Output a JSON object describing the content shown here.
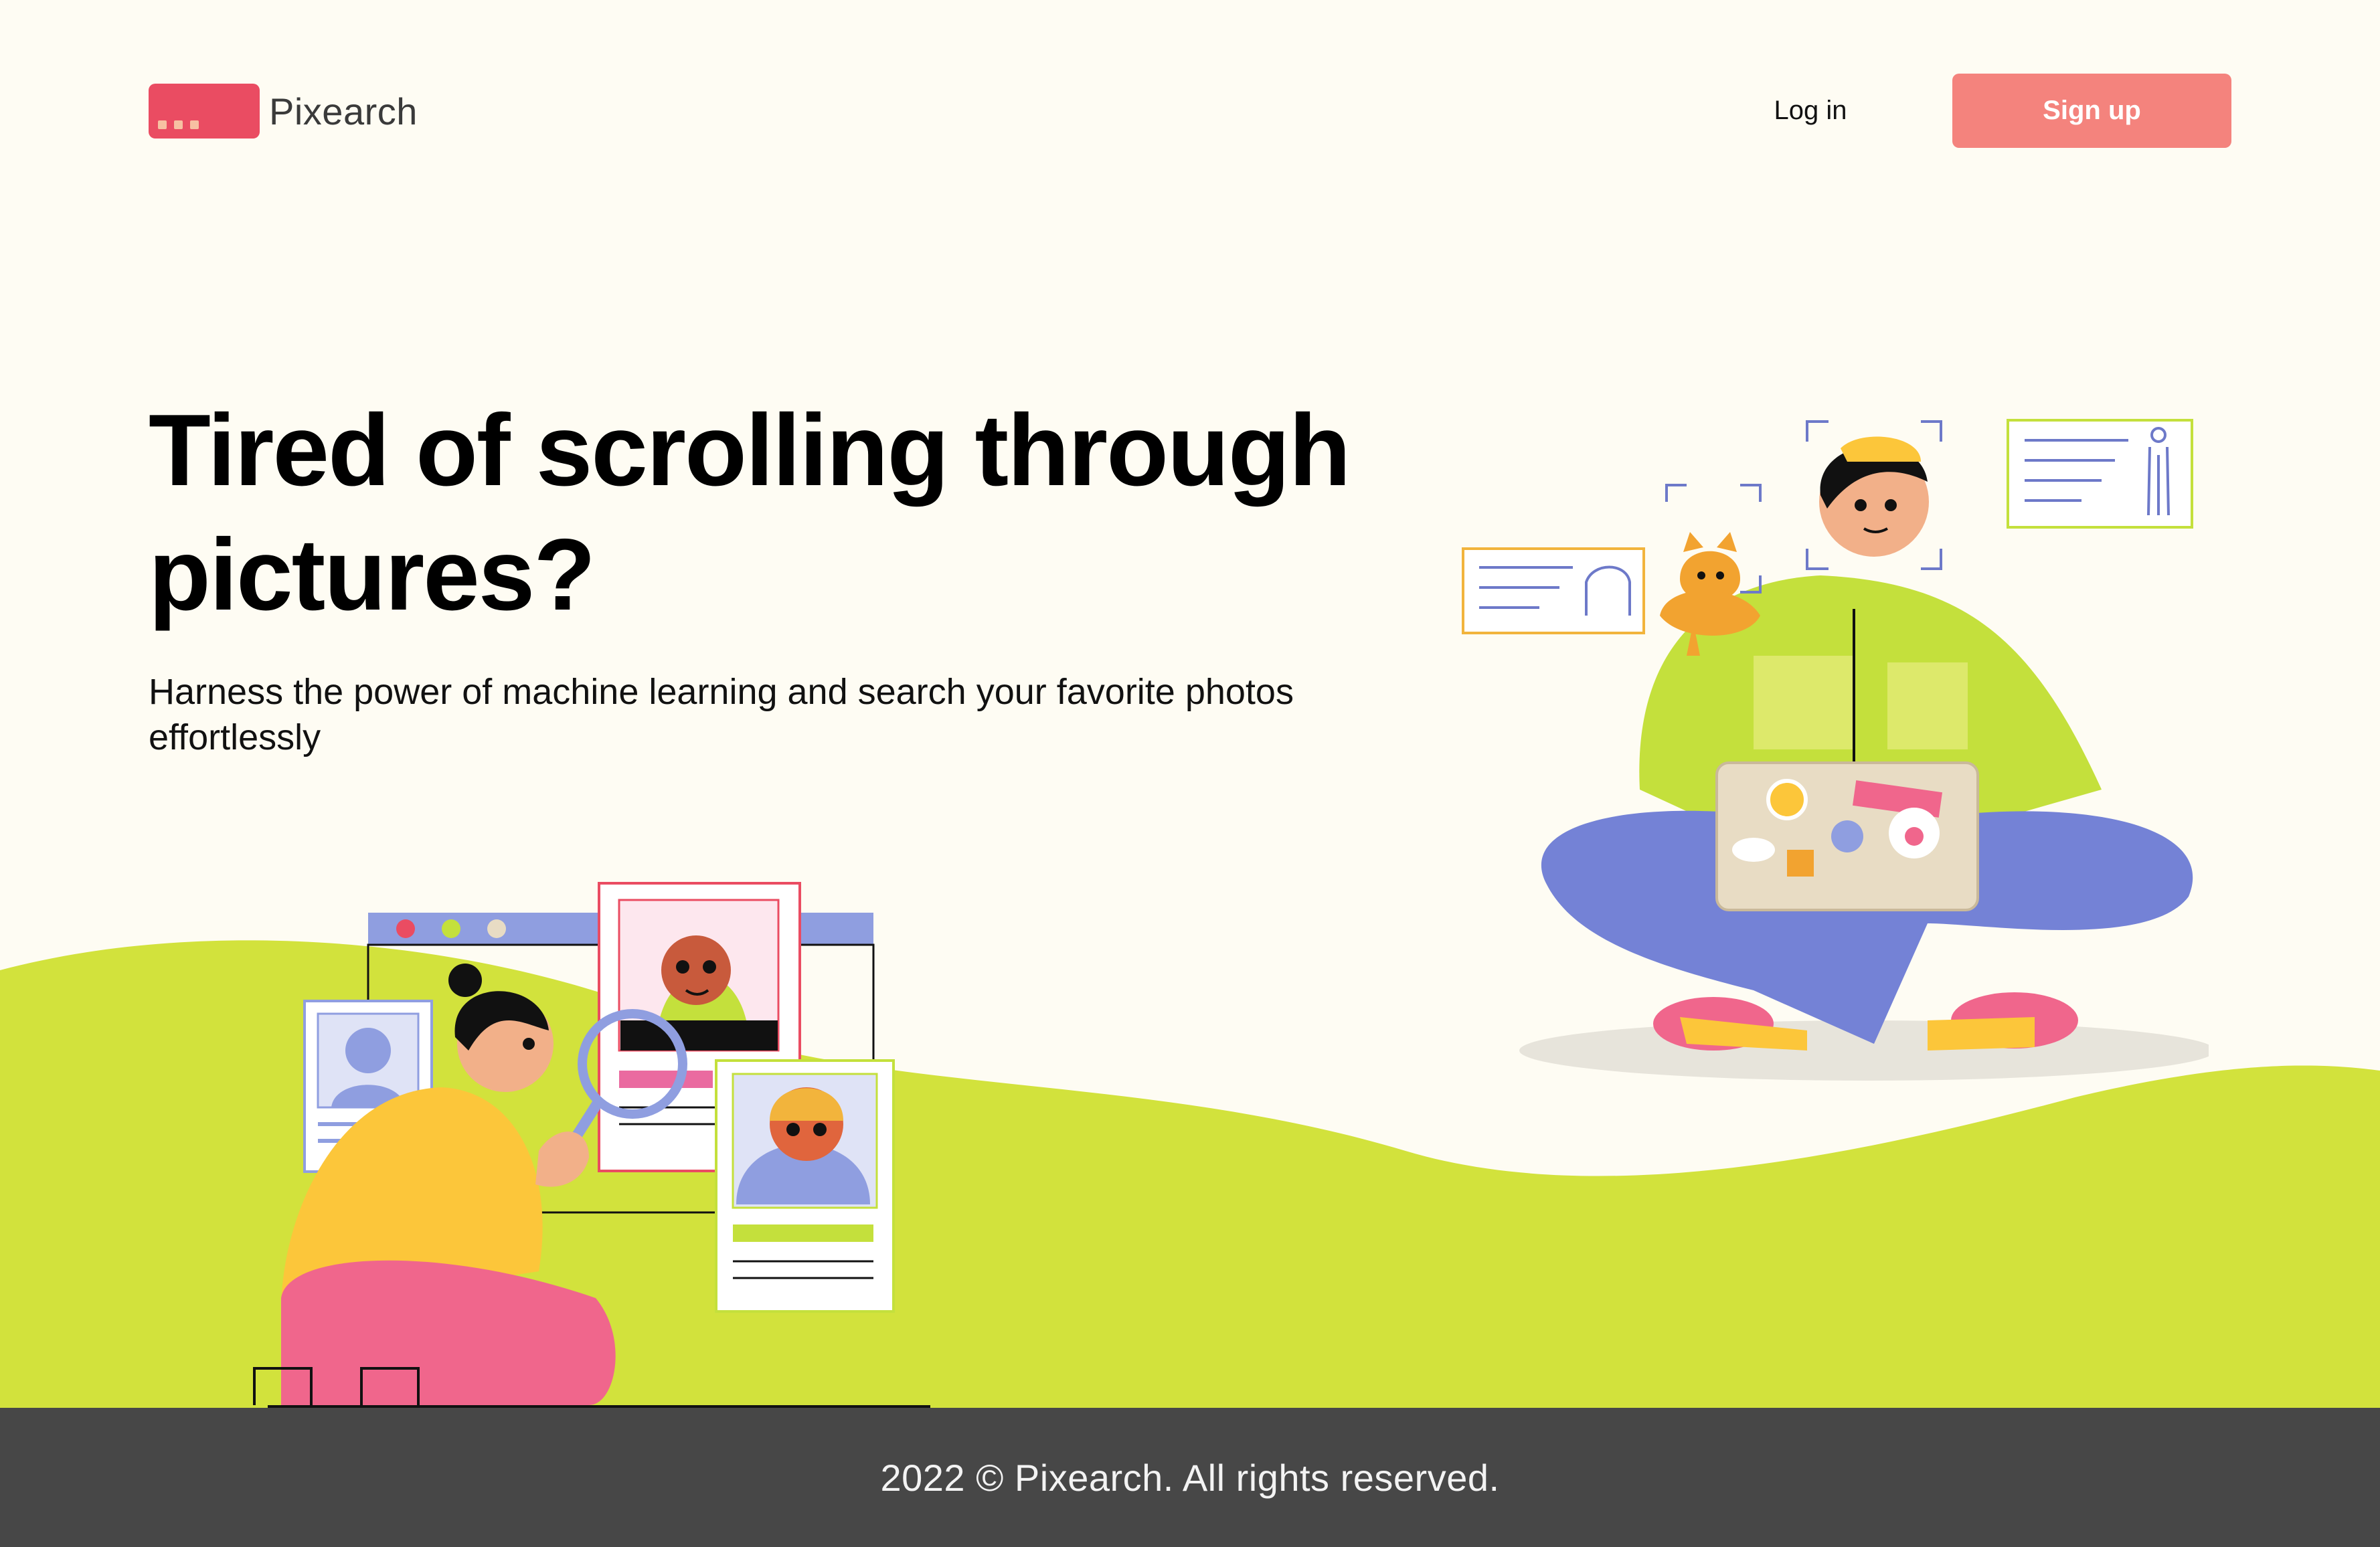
{
  "header": {
    "brand": "Pixearch",
    "login_label": "Log in",
    "signup_label": "Sign up"
  },
  "hero": {
    "headline": "Tired of scrolling through pictures?",
    "subheadline": "Harness the power of machine learning and search your favorite photos effortlessly"
  },
  "footer": {
    "copyright": "2022 © Pixearch. All rights reserved."
  },
  "colors": {
    "background": "#fefcf3",
    "brand": "#ea4c62",
    "signup": "#f4837d",
    "hill": "#d2e23c",
    "footer": "#474747"
  },
  "icons": {
    "logo": "pixearch-logo-icon"
  }
}
